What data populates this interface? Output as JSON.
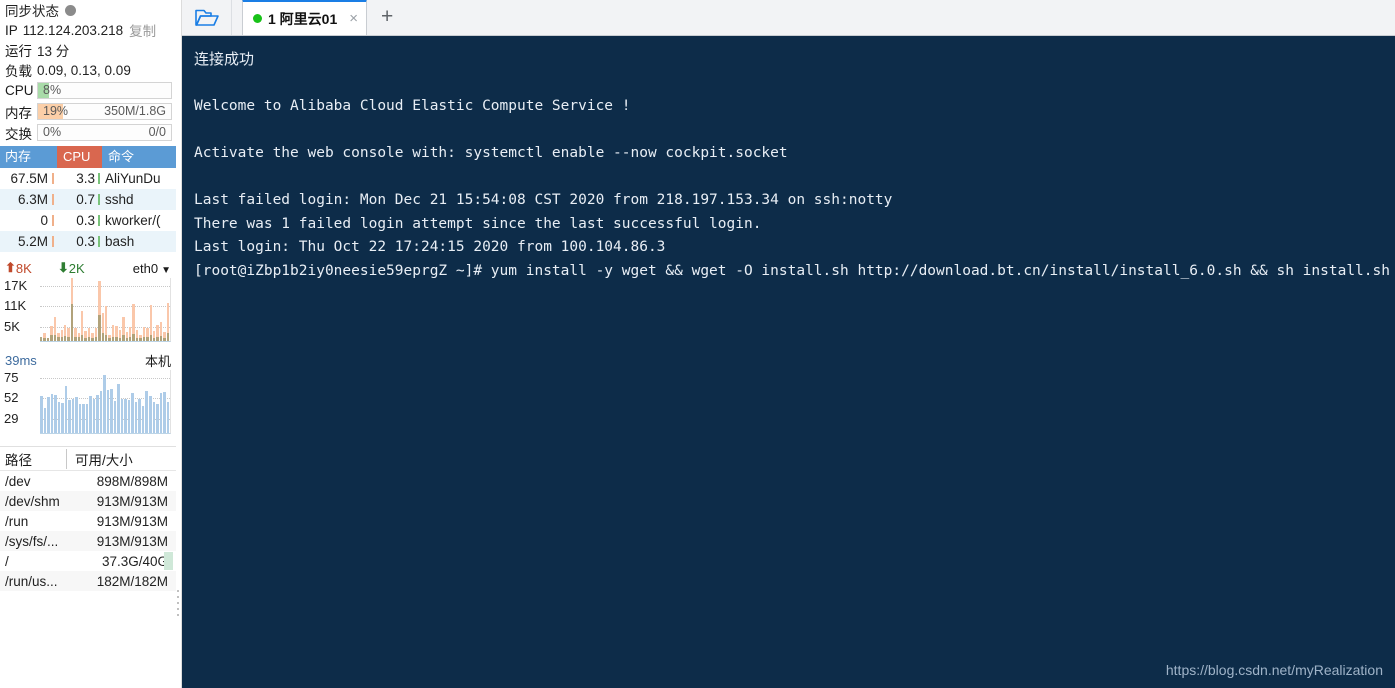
{
  "sidebar": {
    "sync": {
      "label": "同步状态",
      "status_icon": "grey-dot"
    },
    "ip": {
      "label": "IP",
      "value": "112.124.203.218",
      "copy_label": "复制"
    },
    "uptime": {
      "label": "运行",
      "value": "13 分"
    },
    "load": {
      "label": "负载",
      "value": "0.09, 0.13, 0.09"
    },
    "cpu": {
      "label": "CPU",
      "percent": "8%",
      "fill_pct": 8,
      "color": "#a8dba8"
    },
    "mem": {
      "label": "内存",
      "percent": "19%",
      "aux": "350M/1.8G",
      "fill_pct": 19,
      "color": "#fbcfa8"
    },
    "swap": {
      "label": "交换",
      "percent": "0%",
      "aux": "0/0",
      "fill_pct": 0,
      "color": "#cccccc"
    },
    "proc_table": {
      "headers": [
        "内存",
        "CPU",
        "命令"
      ],
      "header_colors": [
        "#5b9bd5",
        "#d9674f",
        "#5b9bd5"
      ],
      "rows": [
        {
          "mem": "67.5M",
          "cpu": "3.3",
          "cmd": "AliYunDu"
        },
        {
          "mem": "6.3M",
          "cpu": "0.7",
          "cmd": "sshd"
        },
        {
          "mem": "0",
          "cpu": "0.3",
          "cmd": "kworker/("
        },
        {
          "mem": "5.2M",
          "cpu": "0.3",
          "cmd": "bash"
        }
      ]
    },
    "net": {
      "up_value": "8K",
      "down_value": "2K",
      "interface": "eth0",
      "y_ticks": [
        "17K",
        "11K",
        "5K"
      ],
      "up_series": [
        2,
        12,
        5,
        24,
        38,
        12,
        18,
        26,
        20,
        100,
        20,
        13,
        48,
        16,
        20,
        13,
        20,
        96,
        45,
        55,
        10,
        26,
        24,
        17,
        38,
        14,
        22,
        58,
        18,
        9,
        22,
        20,
        57,
        16,
        26,
        30,
        14,
        60
      ],
      "down_series": [
        6,
        5,
        5,
        10,
        9,
        6,
        7,
        8,
        7,
        58,
        6,
        6,
        9,
        5,
        6,
        5,
        6,
        42,
        12,
        9,
        5,
        7,
        7,
        5,
        9,
        5,
        6,
        11,
        5,
        5,
        6,
        6,
        10,
        5,
        7,
        8,
        5,
        12
      ]
    },
    "ping": {
      "value": "39ms",
      "host": "本机",
      "y_ticks": [
        "75",
        "52",
        "29"
      ],
      "series": [
        54,
        36,
        52,
        57,
        56,
        45,
        44,
        68,
        48,
        50,
        52,
        43,
        42,
        43,
        54,
        49,
        55,
        62,
        85,
        63,
        65,
        47,
        72,
        50,
        49,
        48,
        58,
        45,
        49,
        40,
        61,
        54,
        46,
        43,
        58,
        60,
        45
      ]
    },
    "disk_table": {
      "headers": [
        "路径",
        "可用/大小"
      ],
      "rows": [
        {
          "path": "/dev",
          "value": "898M/898M",
          "usebar": false
        },
        {
          "path": "/dev/shm",
          "value": "913M/913M",
          "usebar": false
        },
        {
          "path": "/run",
          "value": "913M/913M",
          "usebar": false
        },
        {
          "path": "/sys/fs/...",
          "value": "913M/913M",
          "usebar": false
        },
        {
          "path": "/",
          "value": "37.3G/40G",
          "usebar": true
        },
        {
          "path": "/run/us...",
          "value": "182M/182M",
          "usebar": false
        }
      ]
    }
  },
  "tabbar": {
    "folder_icon": "open-folder-icon",
    "tabs": [
      {
        "index": "1",
        "label": "1  阿里云01",
        "status": "connected",
        "close_glyph": "×"
      }
    ],
    "new_tab_glyph": "+"
  },
  "terminal": {
    "lines": [
      {
        "text": "连接成功",
        "type": "cn"
      },
      {
        "text": "",
        "type": "blank"
      },
      {
        "text": "Welcome to Alibaba Cloud Elastic Compute Service !",
        "type": "mono"
      },
      {
        "text": "",
        "type": "blank"
      },
      {
        "text": "Activate the web console with: systemctl enable --now cockpit.socket",
        "type": "mono"
      },
      {
        "text": "",
        "type": "blank"
      },
      {
        "text": "Last failed login: Mon Dec 21 15:54:08 CST 2020 from 218.197.153.34 on ssh:notty",
        "type": "mono"
      },
      {
        "text": "There was 1 failed login attempt since the last successful login.",
        "type": "mono"
      },
      {
        "text": "Last login: Thu Oct 22 17:24:15 2020 from 100.104.86.3",
        "type": "mono"
      },
      {
        "text": "[root@iZbp1b2iy0neesie59eprgZ ~]# yum install -y wget && wget -O install.sh http://download.bt.cn/install/install_6.0.sh && sh install.sh",
        "type": "mono"
      }
    ],
    "background": "#0d2c49",
    "foreground": "#e8eef5"
  },
  "watermark": "https://blog.csdn.net/myRealization"
}
